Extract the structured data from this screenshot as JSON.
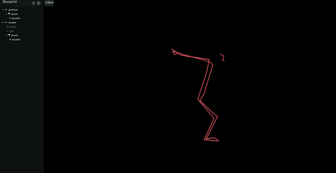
{
  "sidebar": {
    "title": "Blueprint",
    "tree": [
      {
        "label": "person",
        "kind": "group"
      },
      {
        "label": "pose",
        "kind": "entity"
      },
      {
        "label": "points",
        "kind": "leaf"
      },
      {
        "label": "video",
        "kind": "group"
      },
      {
        "label": "mask",
        "kind": "hidden"
      },
      {
        "label": "rgb",
        "kind": "hidden"
      },
      {
        "label": "pose",
        "kind": "entity"
      },
      {
        "label": "points",
        "kind": "leaf"
      }
    ]
  },
  "viewport": {
    "tab_label": "video",
    "pose_color": "#f0606a",
    "background": "#000000"
  },
  "icons": {
    "header": [
      "reset-icon",
      "add-icon"
    ],
    "tree": [
      "chevron-icon",
      "eye-icon",
      "entity-icon"
    ]
  }
}
